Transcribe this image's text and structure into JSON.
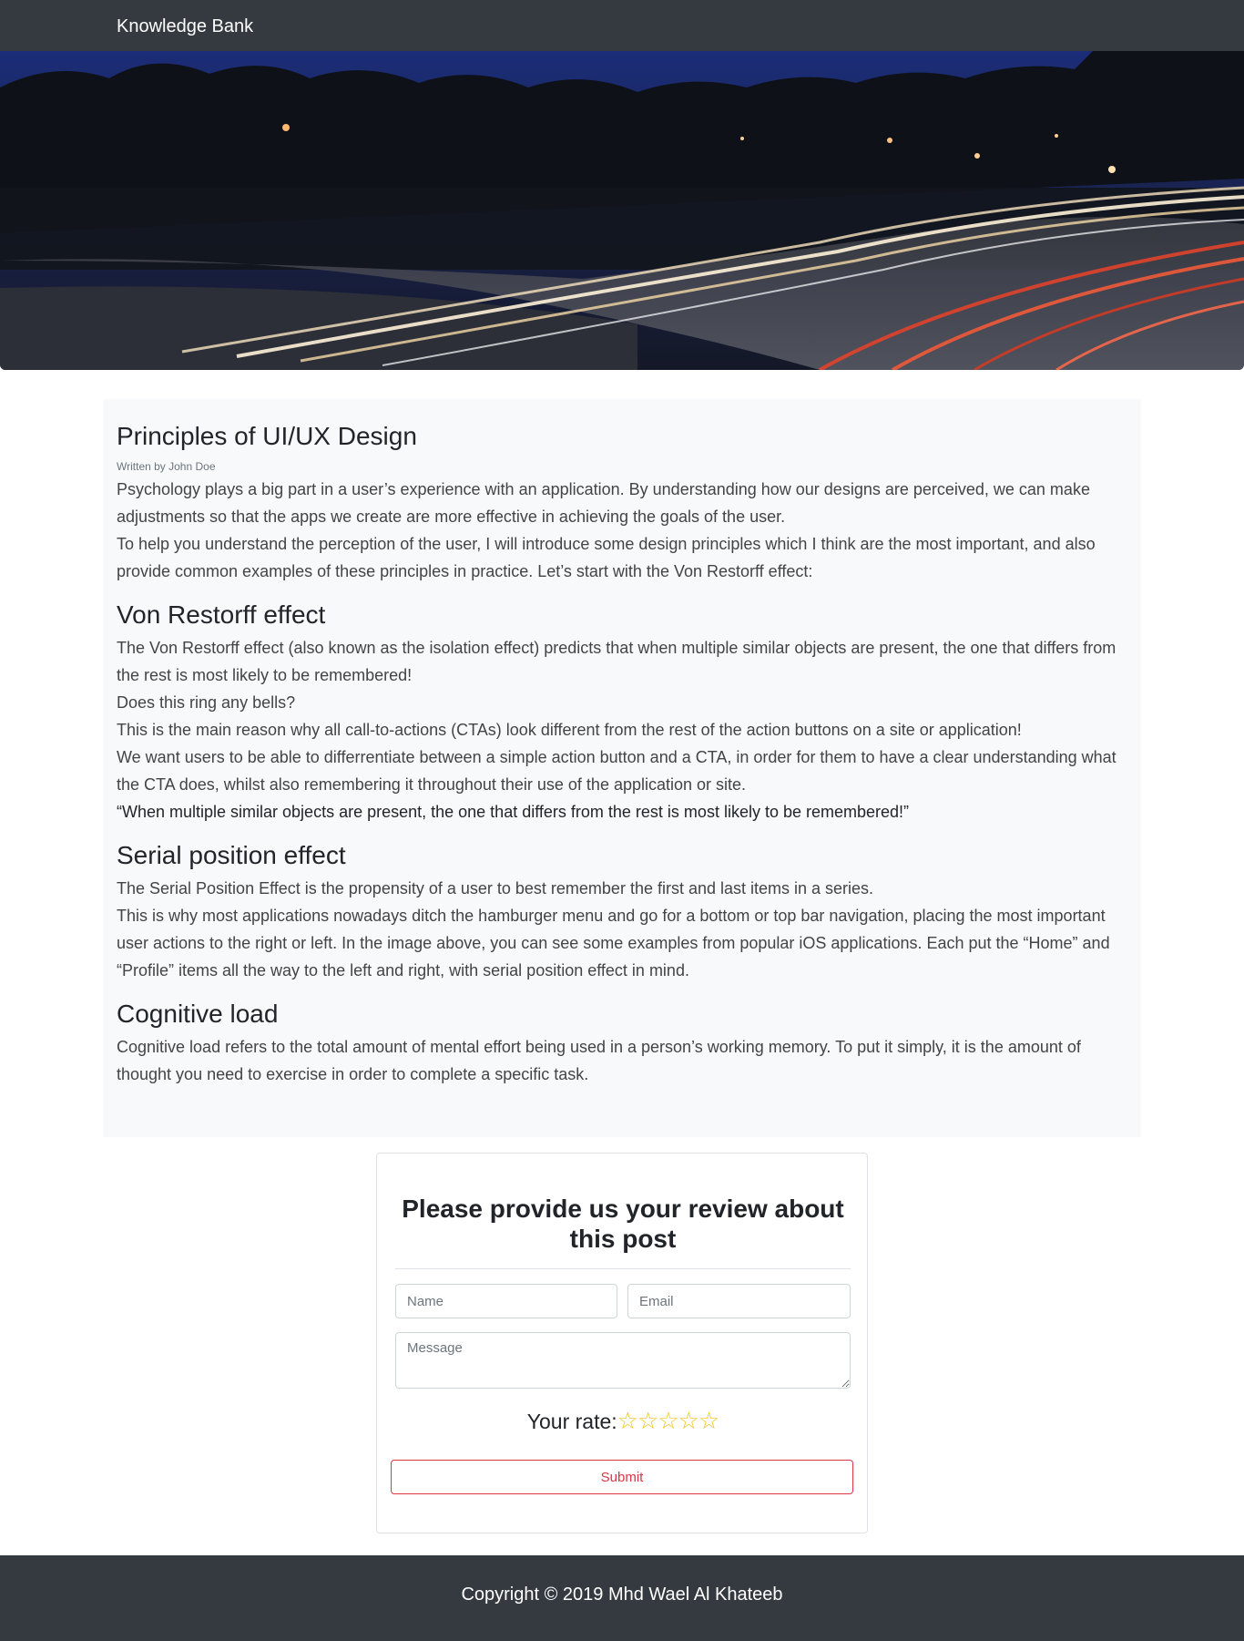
{
  "navbar": {
    "brand": "Knowledge Bank"
  },
  "hero": {
    "image": "night highway light trails"
  },
  "article": {
    "title": "Principles of UI/UX Design",
    "byline": "Written by John Doe",
    "intro": [
      "Psychology plays a big part in a user’s experience with an application. By understanding how our designs are perceived, we can make adjustments so that the apps we create are more effective in achieving the goals of the user.",
      "To help you understand the perception of the user, I will introduce some design principles which I think are the most important, and also provide common examples of these principles in practice. Let’s start with the Von Restorff effect:"
    ],
    "sections": [
      {
        "heading": "Von Restorff effect",
        "paragraphs": [
          "The Von Restorff effect (also known as the isolation effect) predicts that when multiple similar objects are present, the one that differs from the rest is most likely to be remembered!",
          "Does this ring any bells?",
          "This is the main reason why all call-to-actions (CTAs) look different from the rest of the action buttons on a site or application!",
          "We want users to be able to differrentiate between a simple action button and a CTA, in order for them to have a clear understanding what the CTA does, whilst also remembering it throughout their use of the application or site."
        ],
        "quote": "“When multiple similar objects are present, the one that differs from the rest is most likely to be remembered!”"
      },
      {
        "heading": "Serial position effect",
        "paragraphs": [
          "The Serial Position Effect is the propensity of a user to best remember the first and last items in a series.",
          "This is why most applications nowadays ditch the hamburger menu and go for a bottom or top bar navigation, placing the most important user actions to the right or left. In the image above, you can see some examples from popular iOS applications. Each put the “Home” and “Profile” items all the way to the left and right, with serial position effect in mind."
        ]
      },
      {
        "heading": "Cognitive load",
        "paragraphs": [
          "Cognitive load refers to the total amount of mental effort being used in a person’s working memory. To put it simply, it is the amount of thought you need to exercise in order to complete a specific task."
        ]
      }
    ]
  },
  "review": {
    "title": "Please provide us your review about this post",
    "name_placeholder": "Name",
    "email_placeholder": "Email",
    "message_placeholder": "Message",
    "rate_label": "Your rate:",
    "stars_total": 5,
    "stars_selected": 0,
    "star_glyph": "☆",
    "submit_label": "Submit"
  },
  "footer": {
    "copyright": "Copyright © 2019 Mhd Wael Al Khateeb"
  },
  "colors": {
    "navbar": "#343a40",
    "article_bg": "#f8f9fa",
    "accent_danger": "#dc3545",
    "star": "#f0c420"
  }
}
